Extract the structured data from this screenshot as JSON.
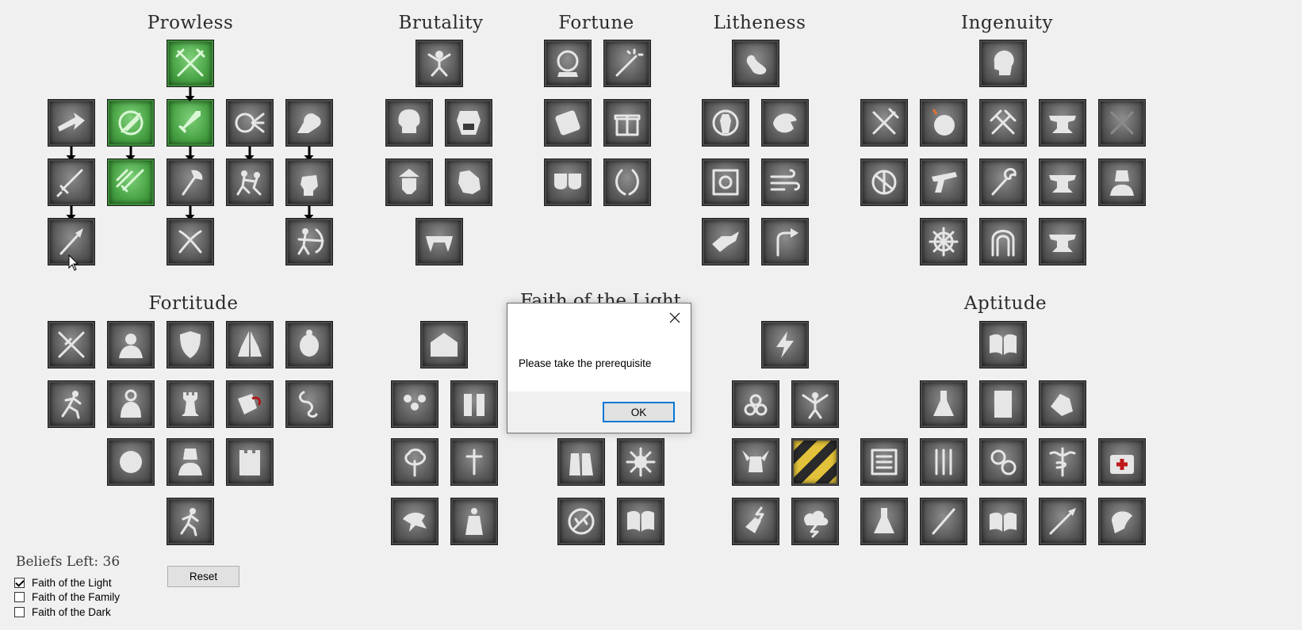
{
  "headings": {
    "prowless": "Prowless",
    "brutality": "Brutality",
    "fortune": "Fortune",
    "litheness": "Litheness",
    "ingenuity": "Ingenuity",
    "fortitude": "Fortitude",
    "faith_of_the_light": "Faith of the Light",
    "aptitude": "Aptitude"
  },
  "beliefs_left": "Beliefs Left: 36",
  "faith_options": [
    {
      "label": "Faith of the Light",
      "checked": true
    },
    {
      "label": "Faith of the Family",
      "checked": false
    },
    {
      "label": "Faith of the Dark",
      "checked": false
    }
  ],
  "reset_label": "Reset",
  "dialog": {
    "message": "Please take the prerequisite",
    "ok_label": "OK"
  },
  "colors": {
    "active_tile": "#4aa546",
    "tile": "#5a5a5a",
    "dialog_ok_border": "#0078d7"
  }
}
